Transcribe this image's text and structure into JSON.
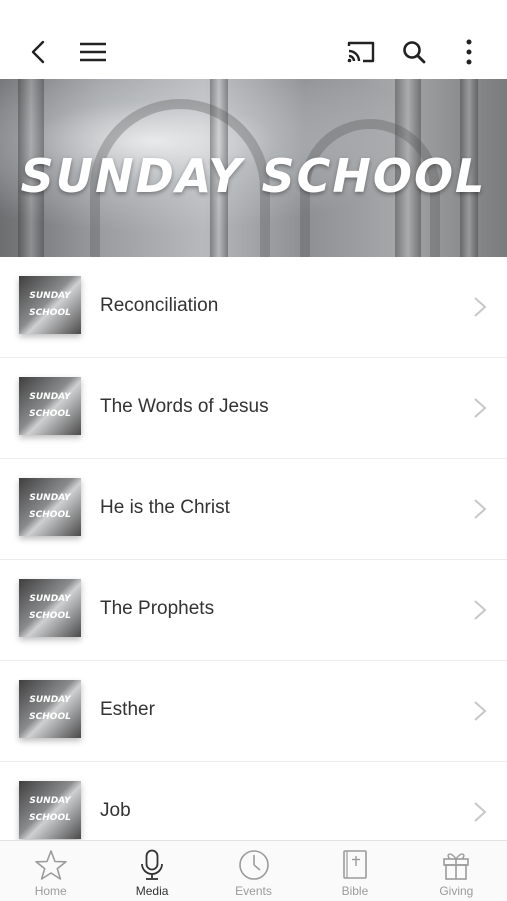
{
  "topbar": {
    "back_icon": "back-chevron-icon",
    "menu_icon": "hamburger-menu-icon",
    "cast_icon": "cast-icon",
    "search_icon": "search-icon",
    "more_icon": "more-vertical-icon"
  },
  "hero": {
    "title": "SUNDAY SCHOOL"
  },
  "thumbnail": {
    "line1": "SUNDAY",
    "line2": "SCHOOL"
  },
  "items": [
    {
      "title": "Reconciliation"
    },
    {
      "title": "The Words of Jesus"
    },
    {
      "title": "He is the Christ"
    },
    {
      "title": "The Prophets"
    },
    {
      "title": "Esther"
    },
    {
      "title": "Job"
    }
  ],
  "tabs": [
    {
      "label": "Home",
      "icon": "star-icon",
      "active": false
    },
    {
      "label": "Media",
      "icon": "microphone-icon",
      "active": true
    },
    {
      "label": "Events",
      "icon": "clock-icon",
      "active": false
    },
    {
      "label": "Bible",
      "icon": "bible-icon",
      "active": false
    },
    {
      "label": "Giving",
      "icon": "gift-icon",
      "active": false
    }
  ],
  "colors": {
    "active_tab": "#333333",
    "inactive_tab": "#9b9b9b",
    "chevron": "#c7c7cc"
  }
}
